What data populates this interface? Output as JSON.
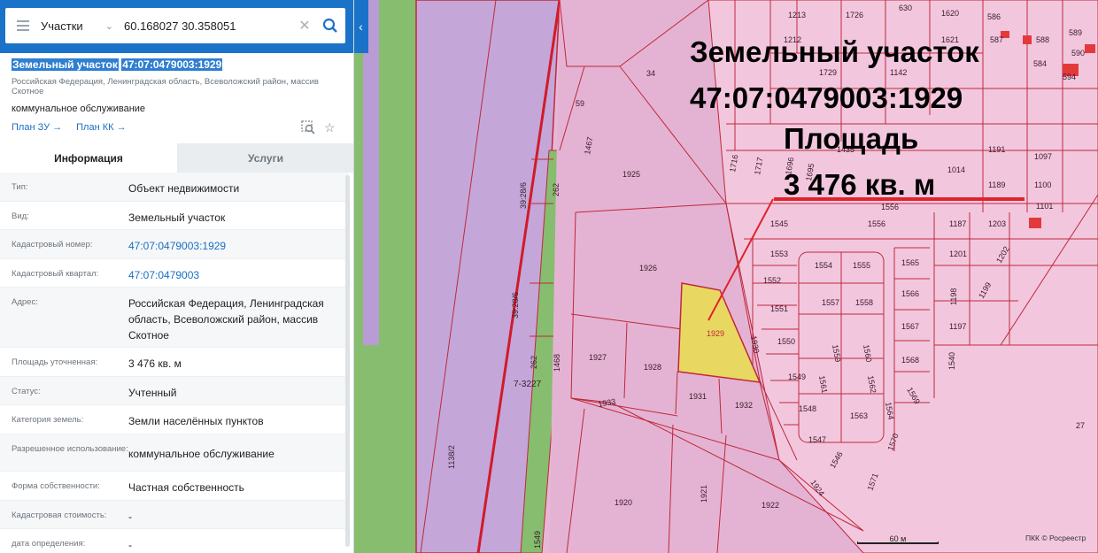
{
  "search": {
    "type_label": "Участки",
    "query": "60.168027 30.358051"
  },
  "parcel": {
    "title_prefix": "Земельный участок",
    "title_number": "47:07:0479003:1929",
    "address": "Российская Федерация, Ленинградская область, Всеволожский район, массив Скотное",
    "usage": "коммунальное обслуживание",
    "links": [
      "План ЗУ →",
      "План КК →"
    ]
  },
  "tabs": [
    {
      "label": "Информация",
      "active": true
    },
    {
      "label": "Услуги",
      "active": false
    }
  ],
  "info_rows": [
    {
      "key": "Тип:",
      "value": "Объект недвижимости",
      "link": false
    },
    {
      "key": "Вид:",
      "value": "Земельный участок",
      "link": false
    },
    {
      "key": "Кадастровый номер:",
      "value": "47:07:0479003:1929",
      "link": true
    },
    {
      "key": "Кадастровый квартал:",
      "value": "47:07:0479003",
      "link": true
    },
    {
      "key": "Адрес:",
      "value": "Российская Федерация, Ленинградская область, Всеволожский район, массив Скотное",
      "link": false
    },
    {
      "key": "Площадь уточненная:",
      "value": "3 476 кв. м",
      "link": false
    },
    {
      "key": "Статус:",
      "value": "Учтенный",
      "link": false
    },
    {
      "key": "Категория земель:",
      "value": "Земли населённых пунктов",
      "link": false
    },
    {
      "key": "Разрешенное использование:",
      "value": "коммунальное обслуживание",
      "link": false
    },
    {
      "key": "Форма собственности:",
      "value": "Частная собственность",
      "link": false
    },
    {
      "key": "Кадастровая стоимость:",
      "value": "-",
      "link": false
    },
    {
      "key": "дата определения:",
      "value": "-",
      "link": false
    }
  ],
  "map": {
    "annotation": {
      "line1": "Земельный участок",
      "line2": "47:07:0479003:1929",
      "line3": "Площадь",
      "line4": "3 476 кв. м"
    },
    "scale_label": "60 м",
    "attribution": "ПКК © Росреестр",
    "parcel_labels": {
      "selected": "1929",
      "road_main": "39:28/6",
      "road_mark": "7-3227",
      "left_strip": "1138/2",
      "others": [
        "34",
        "59",
        "1467",
        "262",
        "1925",
        "1926",
        "1927",
        "1928",
        "1931",
        "1932",
        "1930",
        "1933",
        "1468",
        "262",
        "1920",
        "1921",
        "1922",
        "1924",
        "280",
        "1545",
        "1553",
        "1552",
        "1551",
        "1550",
        "1549",
        "1548",
        "1547",
        "1546",
        "1554",
        "1555",
        "1557",
        "1558",
        "1559",
        "1560",
        "1561",
        "1562",
        "1563",
        "1564",
        "1565",
        "1566",
        "1567",
        "1568",
        "1569",
        "1570",
        "1571",
        "1540",
        "1556",
        "1187",
        "1201",
        "1203",
        "1202",
        "1198",
        "1199",
        "1197",
        "1191",
        "1189",
        "1100",
        "1101",
        "1097",
        "1716",
        "1717",
        "1696",
        "1695",
        "1435",
        "1142",
        "1729",
        "1726",
        "1213",
        "1212",
        "1621",
        "1620",
        "587",
        "588",
        "589",
        "584",
        "590",
        "594",
        "586",
        "630",
        "27"
      ]
    }
  },
  "colors": {
    "accent": "#1a73c9",
    "selected_parcel": "#e8d862",
    "parcel_fill": "#e8b7d6",
    "road_fill": "#c4a7d8",
    "green_strip": "#86bd6f",
    "boundary": "#c0283a"
  }
}
